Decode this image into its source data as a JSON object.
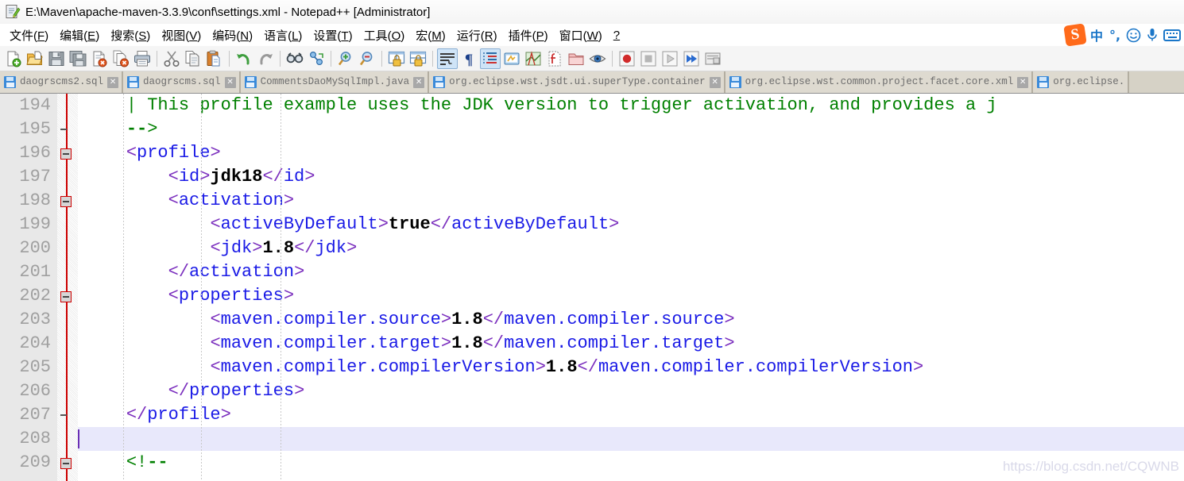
{
  "window": {
    "title": "E:\\Maven\\apache-maven-3.3.9\\conf\\settings.xml - Notepad++ [Administrator]",
    "icon": "notepad-plus-plus-icon"
  },
  "menu": {
    "items": [
      {
        "label": "文件(F)",
        "text": "文件(",
        "mnemonic": "F",
        "tail": ")"
      },
      {
        "label": "编辑(E)",
        "text": "编辑(",
        "mnemonic": "E",
        "tail": ")"
      },
      {
        "label": "搜索(S)",
        "text": "搜索(",
        "mnemonic": "S",
        "tail": ")"
      },
      {
        "label": "视图(V)",
        "text": "视图(",
        "mnemonic": "V",
        "tail": ")"
      },
      {
        "label": "编码(N)",
        "text": "编码(",
        "mnemonic": "N",
        "tail": ")"
      },
      {
        "label": "语言(L)",
        "text": "语言(",
        "mnemonic": "L",
        "tail": ")"
      },
      {
        "label": "设置(T)",
        "text": "设置(",
        "mnemonic": "T",
        "tail": ")"
      },
      {
        "label": "工具(O)",
        "text": "工具(",
        "mnemonic": "O",
        "tail": ")"
      },
      {
        "label": "宏(M)",
        "text": "宏(",
        "mnemonic": "M",
        "tail": ")"
      },
      {
        "label": "运行(R)",
        "text": "运行(",
        "mnemonic": "R",
        "tail": ")"
      },
      {
        "label": "插件(P)",
        "text": "插件(",
        "mnemonic": "P",
        "tail": ")"
      },
      {
        "label": "窗口(W)",
        "text": "窗口(",
        "mnemonic": "W",
        "tail": ")"
      },
      {
        "label": "?",
        "text": "",
        "mnemonic": "?",
        "tail": ""
      }
    ]
  },
  "ime": {
    "logo_text": "S",
    "mode_label": "中",
    "punct_label": "°,",
    "emoji_label": "☺",
    "mic_label": "mic",
    "keyboard_label": "keyboard"
  },
  "toolbar": {
    "buttons": [
      {
        "name": "new-file-icon",
        "title": "新建"
      },
      {
        "name": "open-file-icon",
        "title": "打开"
      },
      {
        "name": "save-icon",
        "title": "保存"
      },
      {
        "name": "save-all-icon",
        "title": "全部保存"
      },
      {
        "name": "close-file-icon",
        "title": "关闭"
      },
      {
        "name": "close-all-files-icon",
        "title": "全部关闭"
      },
      {
        "name": "print-icon",
        "title": "打印"
      },
      {
        "name": "separator-1",
        "title": ""
      },
      {
        "name": "cut-icon",
        "title": "剪切"
      },
      {
        "name": "copy-icon",
        "title": "复制"
      },
      {
        "name": "paste-icon",
        "title": "粘贴"
      },
      {
        "name": "separator-2",
        "title": ""
      },
      {
        "name": "undo-icon",
        "title": "撤销"
      },
      {
        "name": "redo-icon",
        "title": "重做"
      },
      {
        "name": "separator-3",
        "title": ""
      },
      {
        "name": "find-icon",
        "title": "查找"
      },
      {
        "name": "replace-icon",
        "title": "替换"
      },
      {
        "name": "separator-4",
        "title": ""
      },
      {
        "name": "zoom-in-icon",
        "title": "放大"
      },
      {
        "name": "zoom-out-icon",
        "title": "缩小"
      },
      {
        "name": "separator-5",
        "title": ""
      },
      {
        "name": "sync-vertical-scroll-icon",
        "title": "同步垂直滚动"
      },
      {
        "name": "sync-horizontal-scroll-icon",
        "title": "同步水平滚动"
      },
      {
        "name": "separator-6",
        "title": ""
      },
      {
        "name": "word-wrap-icon",
        "title": "自动换行",
        "active": true
      },
      {
        "name": "show-all-characters-icon",
        "title": "显示所有字符"
      },
      {
        "name": "show-indent-guide-icon",
        "title": "显示缩进参考线",
        "active": true
      },
      {
        "name": "user-defined-language-icon",
        "title": "用户自定义语言"
      },
      {
        "name": "document-map-icon",
        "title": "文档地图"
      },
      {
        "name": "function-list-icon",
        "title": "函数列表"
      },
      {
        "name": "folder-as-workspace-icon",
        "title": "文件夹作为工作区"
      },
      {
        "name": "monitoring-icon",
        "title": "监视"
      },
      {
        "name": "separator-7",
        "title": ""
      },
      {
        "name": "record-macro-icon",
        "title": "开始录制宏"
      },
      {
        "name": "stop-macro-icon",
        "title": "停止录制宏"
      },
      {
        "name": "play-macro-icon",
        "title": "播放宏"
      },
      {
        "name": "run-macro-multiple-icon",
        "title": "多次运行宏"
      },
      {
        "name": "save-macro-icon",
        "title": "保存当前录制的宏"
      }
    ]
  },
  "tabs": [
    {
      "label": "daogrscms2.sql",
      "active": false,
      "closable": true
    },
    {
      "label": "daogrscms.sql",
      "active": false,
      "closable": true
    },
    {
      "label": "CommentsDaoMySqlImpl.java",
      "active": false,
      "closable": true
    },
    {
      "label": "org.eclipse.wst.jsdt.ui.superType.container",
      "active": false,
      "closable": true
    },
    {
      "label": "org.eclipse.wst.common.project.facet.core.xml",
      "active": false,
      "closable": true
    },
    {
      "label": "org.eclipse.",
      "active": false,
      "closable": false
    }
  ],
  "editor": {
    "watermark": "https://blog.csdn.net/CQWNB",
    "lines": [
      {
        "num": "194",
        "fold": "none",
        "current": false,
        "tokens": [
          {
            "t": "    ",
            "c": "plain"
          },
          {
            "t": "| This profile example uses the JDK version to trigger activation, and provides a j",
            "c": "cmt"
          }
        ]
      },
      {
        "num": "195",
        "fold": "tick",
        "current": false,
        "tokens": [
          {
            "t": "    ",
            "c": "plain"
          },
          {
            "t": "--",
            "c": "cmt-b"
          },
          {
            "t": ">",
            "c": "cmt"
          }
        ]
      },
      {
        "num": "196",
        "fold": "box",
        "current": false,
        "tokens": [
          {
            "t": "    ",
            "c": "plain"
          },
          {
            "t": "<",
            "c": "brk"
          },
          {
            "t": "profile",
            "c": "tg"
          },
          {
            "t": ">",
            "c": "brk"
          }
        ]
      },
      {
        "num": "197",
        "fold": "none",
        "current": false,
        "tokens": [
          {
            "t": "        ",
            "c": "plain"
          },
          {
            "t": "<",
            "c": "brk"
          },
          {
            "t": "id",
            "c": "tg"
          },
          {
            "t": ">",
            "c": "brk"
          },
          {
            "t": "jdk18",
            "c": "val"
          },
          {
            "t": "</",
            "c": "brk"
          },
          {
            "t": "id",
            "c": "tg"
          },
          {
            "t": ">",
            "c": "brk"
          }
        ]
      },
      {
        "num": "198",
        "fold": "box",
        "current": false,
        "tokens": [
          {
            "t": "        ",
            "c": "plain"
          },
          {
            "t": "<",
            "c": "brk"
          },
          {
            "t": "activation",
            "c": "tg"
          },
          {
            "t": ">",
            "c": "brk"
          }
        ]
      },
      {
        "num": "199",
        "fold": "none",
        "current": false,
        "tokens": [
          {
            "t": "            ",
            "c": "plain"
          },
          {
            "t": "<",
            "c": "brk"
          },
          {
            "t": "activeByDefault",
            "c": "tg"
          },
          {
            "t": ">",
            "c": "brk"
          },
          {
            "t": "true",
            "c": "val"
          },
          {
            "t": "</",
            "c": "brk"
          },
          {
            "t": "activeByDefault",
            "c": "tg"
          },
          {
            "t": ">",
            "c": "brk"
          }
        ]
      },
      {
        "num": "200",
        "fold": "none",
        "current": false,
        "tokens": [
          {
            "t": "            ",
            "c": "plain"
          },
          {
            "t": "<",
            "c": "brk"
          },
          {
            "t": "jdk",
            "c": "tg"
          },
          {
            "t": ">",
            "c": "brk"
          },
          {
            "t": "1.8",
            "c": "val"
          },
          {
            "t": "</",
            "c": "brk"
          },
          {
            "t": "jdk",
            "c": "tg"
          },
          {
            "t": ">",
            "c": "brk"
          }
        ]
      },
      {
        "num": "201",
        "fold": "none",
        "current": false,
        "tokens": [
          {
            "t": "        ",
            "c": "plain"
          },
          {
            "t": "</",
            "c": "brk"
          },
          {
            "t": "activation",
            "c": "tg"
          },
          {
            "t": ">",
            "c": "brk"
          }
        ]
      },
      {
        "num": "202",
        "fold": "box",
        "current": false,
        "tokens": [
          {
            "t": "        ",
            "c": "plain"
          },
          {
            "t": "<",
            "c": "brk"
          },
          {
            "t": "properties",
            "c": "tg"
          },
          {
            "t": ">",
            "c": "brk"
          }
        ]
      },
      {
        "num": "203",
        "fold": "none",
        "current": false,
        "tokens": [
          {
            "t": "            ",
            "c": "plain"
          },
          {
            "t": "<",
            "c": "brk"
          },
          {
            "t": "maven.compiler.source",
            "c": "tg"
          },
          {
            "t": ">",
            "c": "brk"
          },
          {
            "t": "1.8",
            "c": "val"
          },
          {
            "t": "</",
            "c": "brk"
          },
          {
            "t": "maven.compiler.source",
            "c": "tg"
          },
          {
            "t": ">",
            "c": "brk"
          }
        ]
      },
      {
        "num": "204",
        "fold": "none",
        "current": false,
        "tokens": [
          {
            "t": "            ",
            "c": "plain"
          },
          {
            "t": "<",
            "c": "brk"
          },
          {
            "t": "maven.compiler.target",
            "c": "tg"
          },
          {
            "t": ">",
            "c": "brk"
          },
          {
            "t": "1.8",
            "c": "val"
          },
          {
            "t": "</",
            "c": "brk"
          },
          {
            "t": "maven.compiler.target",
            "c": "tg"
          },
          {
            "t": ">",
            "c": "brk"
          }
        ]
      },
      {
        "num": "205",
        "fold": "none",
        "current": false,
        "tokens": [
          {
            "t": "            ",
            "c": "plain"
          },
          {
            "t": "<",
            "c": "brk"
          },
          {
            "t": "maven.compiler.compilerVersion",
            "c": "tg"
          },
          {
            "t": ">",
            "c": "brk"
          },
          {
            "t": "1.8",
            "c": "val"
          },
          {
            "t": "</",
            "c": "brk"
          },
          {
            "t": "maven.compiler.compilerVersion",
            "c": "tg"
          },
          {
            "t": ">",
            "c": "brk"
          }
        ]
      },
      {
        "num": "206",
        "fold": "none",
        "current": false,
        "tokens": [
          {
            "t": "        ",
            "c": "plain"
          },
          {
            "t": "</",
            "c": "brk"
          },
          {
            "t": "properties",
            "c": "tg"
          },
          {
            "t": ">",
            "c": "brk"
          }
        ]
      },
      {
        "num": "207",
        "fold": "tick",
        "current": false,
        "tokens": [
          {
            "t": "    ",
            "c": "plain"
          },
          {
            "t": "</",
            "c": "brk"
          },
          {
            "t": "profile",
            "c": "tg"
          },
          {
            "t": ">",
            "c": "brk"
          }
        ]
      },
      {
        "num": "208",
        "fold": "none",
        "current": true,
        "tokens": [
          {
            "t": "",
            "c": "plain"
          }
        ]
      },
      {
        "num": "209",
        "fold": "box",
        "current": false,
        "tokens": [
          {
            "t": "    ",
            "c": "plain"
          },
          {
            "t": "<!",
            "c": "cmt"
          },
          {
            "t": "--",
            "c": "cmt-b"
          }
        ]
      }
    ],
    "indent_guide_columns": [
      4,
      8,
      12
    ]
  },
  "colors": {
    "comment": "#008000",
    "tag": "#1a1ae6",
    "bracket": "#7b2fbe",
    "value": "#000000",
    "gutter_bg": "#e8e8e8",
    "gutter_fg": "#a0a0a0",
    "fold_line": "#cc0000",
    "current_line_bg": "#e8e8fb",
    "caret": "#6a2fb5",
    "tab_bar_bg": "#d6d2c6",
    "accent": "#3a8ad9"
  }
}
